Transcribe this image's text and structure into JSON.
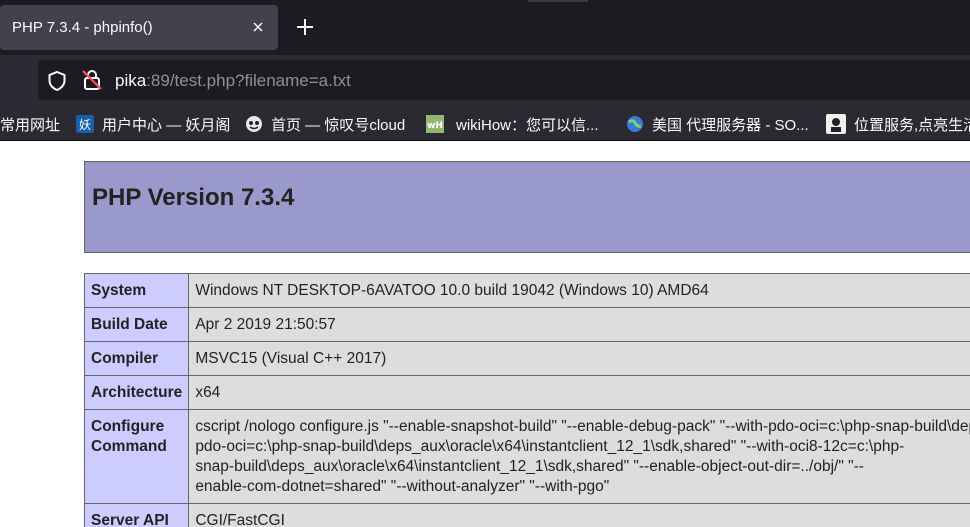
{
  "tab": {
    "title": "PHP 7.3.4 - phpinfo()"
  },
  "nav": {
    "url_host": "pika",
    "url_rest": ":89/test.php?filename=a.txt"
  },
  "bookmarks": [
    {
      "label": "常用网址",
      "icon": "folder-icon"
    },
    {
      "label": "用户中心 — 妖月阁",
      "icon": "yao-favicon",
      "icon_text": "妖",
      "icon_color": "#1a5ea8"
    },
    {
      "label": "首页 — 惊叹号cloud",
      "icon": "cloud-favicon"
    },
    {
      "label": "wikiHow：您可以信...",
      "icon": "wikihow-favicon",
      "icon_text": "wH",
      "icon_color": "#93b874"
    },
    {
      "label": "美国 代理服务器 - SO...",
      "icon": "globe-favicon"
    },
    {
      "label": "位置服务,点亮生活",
      "icon": "location-favicon"
    }
  ],
  "php": {
    "title": "PHP Version 7.3.4",
    "rows": [
      {
        "key": "System",
        "value": [
          "Windows NT DESKTOP-6AVATOO 10.0 build 19042 (Windows 10) AMD64"
        ]
      },
      {
        "key": "Build Date",
        "value": [
          "Apr 2 2019 21:50:57"
        ]
      },
      {
        "key": "Compiler",
        "value": [
          "MSVC15 (Visual C++ 2017)"
        ]
      },
      {
        "key": "Architecture",
        "value": [
          "x64"
        ]
      },
      {
        "key": "Configure Command",
        "value": [
          "cscript /nologo configure.js \"--enable-snapshot-build\" \"--enable-debug-pack\" \"--with-pdo-oci=c:\\php-snap-build\\deps_aux\\oracle\\x64\\instantclient_12_1\\sdk,shared\"",
          "pdo-oci=c:\\php-snap-build\\deps_aux\\oracle\\x64\\instantclient_12_1\\sdk,shared\" \"--with-oci8-12c=c:\\php-",
          "snap-build\\deps_aux\\oracle\\x64\\instantclient_12_1\\sdk,shared\" \"--enable-object-out-dir=../obj/\" \"--",
          "enable-com-dotnet=shared\" \"--without-analyzer\" \"--with-pgo\""
        ]
      },
      {
        "key": "Server API",
        "value": [
          "CGI/FastCGI"
        ]
      },
      {
        "key": "",
        "value": [
          ""
        ]
      }
    ]
  }
}
